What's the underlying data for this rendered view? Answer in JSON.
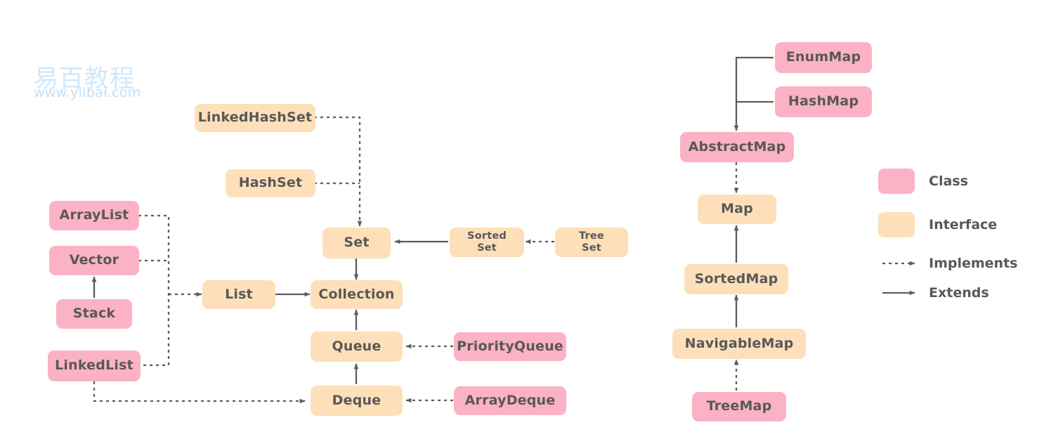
{
  "watermark": {
    "cn": "易百教程",
    "url": "www.yiibai.com"
  },
  "legend": {
    "class_label": "Class",
    "interface_label": "Interface",
    "implements_label": "Implements",
    "extends_label": "Extends",
    "class_color": "#fbb2c5",
    "interface_color": "#fde0b9",
    "line_color": "#5c5c5c"
  },
  "colors": {
    "class": "#fbb2c5",
    "interface": "#fde0b9",
    "text": "#585858",
    "edge": "#5c5c5c",
    "background": "#ffffff"
  },
  "nodes": {
    "arraylist": {
      "label": "ArrayList",
      "kind": "class"
    },
    "vector": {
      "label": "Vector",
      "kind": "class"
    },
    "stack": {
      "label": "Stack",
      "kind": "class"
    },
    "linkedlist": {
      "label": "LinkedList",
      "kind": "class"
    },
    "linkedhashset": {
      "label": "LinkedHashSet",
      "kind": "interface"
    },
    "hashset": {
      "label": "HashSet",
      "kind": "interface"
    },
    "set": {
      "label": "Set",
      "kind": "interface"
    },
    "sortedset": {
      "label": "Sorted\nSet",
      "kind": "interface"
    },
    "treeset": {
      "label": "Tree\nSet",
      "kind": "interface"
    },
    "list": {
      "label": "List",
      "kind": "interface"
    },
    "collection": {
      "label": "Collection",
      "kind": "interface"
    },
    "queue": {
      "label": "Queue",
      "kind": "interface"
    },
    "priorityqueue": {
      "label": "PriorityQueue",
      "kind": "class"
    },
    "deque": {
      "label": "Deque",
      "kind": "interface"
    },
    "arraydeque": {
      "label": "ArrayDeque",
      "kind": "class"
    },
    "enummap": {
      "label": "EnumMap",
      "kind": "class"
    },
    "hashmap": {
      "label": "HashMap",
      "kind": "class"
    },
    "abstractmap": {
      "label": "AbstractMap",
      "kind": "class"
    },
    "map": {
      "label": "Map",
      "kind": "interface"
    },
    "sortedmap": {
      "label": "SortedMap",
      "kind": "interface"
    },
    "navigablemap": {
      "label": "NavigableMap",
      "kind": "interface"
    },
    "treemap": {
      "label": "TreeMap",
      "kind": "class"
    }
  },
  "edges": [
    {
      "from": "arraylist",
      "to": "list",
      "type": "implements"
    },
    {
      "from": "vector",
      "to": "list",
      "type": "implements"
    },
    {
      "from": "linkedlist",
      "to": "list",
      "type": "implements"
    },
    {
      "from": "stack",
      "to": "vector",
      "type": "extends"
    },
    {
      "from": "linkedlist",
      "to": "deque",
      "type": "implements"
    },
    {
      "from": "linkedhashset",
      "to": "set",
      "type": "implements"
    },
    {
      "from": "hashset",
      "to": "set",
      "type": "implements"
    },
    {
      "from": "treeset",
      "to": "sortedset",
      "type": "implements"
    },
    {
      "from": "sortedset",
      "to": "set",
      "type": "extends"
    },
    {
      "from": "set",
      "to": "collection",
      "type": "extends"
    },
    {
      "from": "list",
      "to": "collection",
      "type": "extends"
    },
    {
      "from": "queue",
      "to": "collection",
      "type": "extends"
    },
    {
      "from": "deque",
      "to": "queue",
      "type": "extends"
    },
    {
      "from": "priorityqueue",
      "to": "queue",
      "type": "implements"
    },
    {
      "from": "arraydeque",
      "to": "deque",
      "type": "implements"
    },
    {
      "from": "enummap",
      "to": "abstractmap",
      "type": "extends"
    },
    {
      "from": "hashmap",
      "to": "abstractmap",
      "type": "extends"
    },
    {
      "from": "abstractmap",
      "to": "map",
      "type": "implements"
    },
    {
      "from": "sortedmap",
      "to": "map",
      "type": "extends"
    },
    {
      "from": "navigablemap",
      "to": "sortedmap",
      "type": "extends"
    },
    {
      "from": "treemap",
      "to": "navigablemap",
      "type": "implements"
    }
  ]
}
